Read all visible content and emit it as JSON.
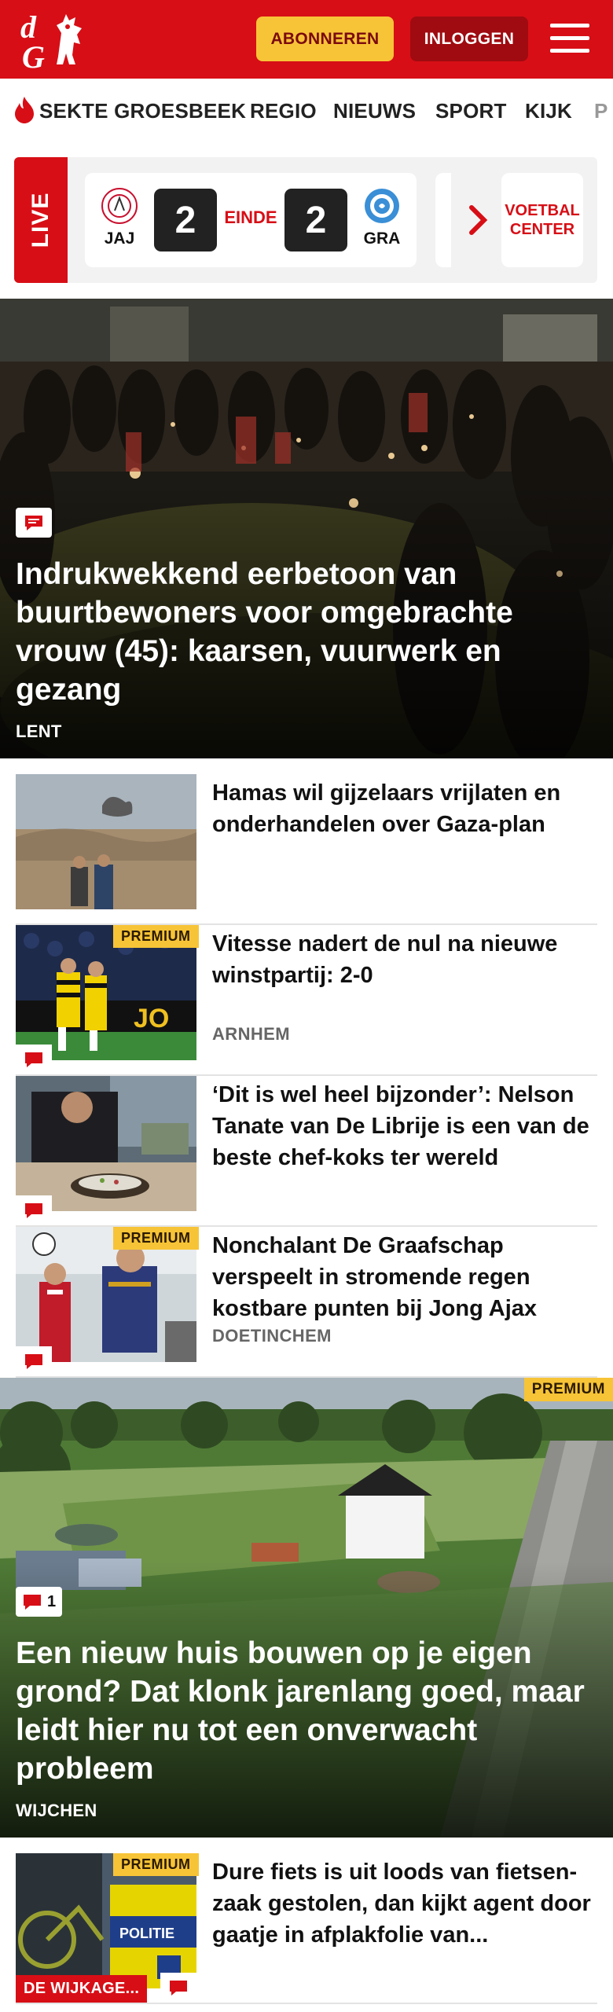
{
  "header": {
    "logo_text": "dG",
    "subscribe_label": "ABONNEREN",
    "login_label": "INLOGGEN"
  },
  "nav": {
    "items": [
      "SEKTE GROESBEEK",
      "REGIO",
      "NIEUWS",
      "SPORT",
      "KIJK",
      "P"
    ]
  },
  "live": {
    "label": "LIVE",
    "home_team": "JAJ",
    "away_team": "GRA",
    "home_score": "2",
    "away_score": "2",
    "status": "EINDE",
    "center_line1": "VOETBAL",
    "center_line2": "CENTER"
  },
  "hero1": {
    "title": "Indrukwekkend eerbetoon van buurtbewoners voor omgebrachte vrouw (45): kaarsen, vuurwerk en gezang",
    "location": "LENT"
  },
  "articles": [
    {
      "title": "Hamas wil gijzelaars vrijlaten en onderhandelen over Gaza-plan",
      "location": "",
      "premium": false
    },
    {
      "title": "Vitesse nadert de nul na nieuwe winstpartij: 2-0",
      "location": "ARNHEM",
      "premium": true,
      "premium_label": "PREMIUM"
    },
    {
      "title": "‘Dit is wel heel bijzonder’: Nelson Tanate van De Librije is een van de beste chef-koks ter wereld",
      "location": "",
      "premium": false
    },
    {
      "title": "Nonchalant De Graafschap verspeelt in stromende regen kostbare punten bij Jong Ajax",
      "location": "DOETINCHEM",
      "premium": true,
      "premium_label": "PREMIUM"
    }
  ],
  "hero2": {
    "premium_label": "PREMIUM",
    "comment_count": "1",
    "title": "Een nieuw huis bouwen op je eigen grond? Dat klonk jarenlang goed, maar leidt hier nu tot een onverwacht probleem",
    "location": "WIJCHEN"
  },
  "article_last": {
    "title": "Dure fiets is uit loods van fietsen­zaak gestolen, dan kijkt agent door gaatje in afplakfolie van...",
    "premium_label": "PREMIUM",
    "tag": "DE WIJKAGE..."
  },
  "colors": {
    "brand_red": "#d70e16",
    "premium_yellow": "#f7c437",
    "login_dark_red": "#9f0b10"
  },
  "icons": [
    "logo-icon",
    "menu-icon",
    "flame-icon",
    "comment-icon",
    "chevron-right-icon"
  ]
}
